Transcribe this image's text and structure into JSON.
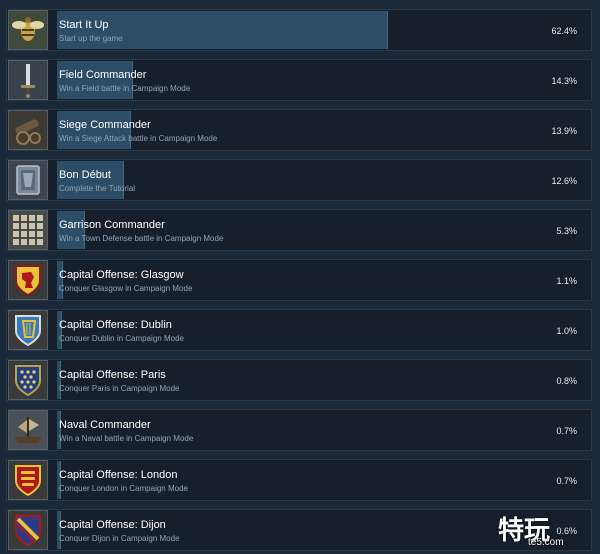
{
  "achievements": [
    {
      "title": "Start It Up",
      "description": "Start up the game",
      "percent_label": "62.4%",
      "percent": 62.4,
      "icon": "bee-emblem-icon"
    },
    {
      "title": "Field Commander",
      "description": "Win a Field battle in Campaign Mode",
      "percent_label": "14.3%",
      "percent": 14.3,
      "icon": "sword-icon"
    },
    {
      "title": "Siege Commander",
      "description": "Win a Siege Attack battle in Campaign Mode",
      "percent_label": "13.9%",
      "percent": 13.9,
      "icon": "cannon-icon"
    },
    {
      "title": "Bon Début",
      "description": "Complete the Tutorial",
      "percent_label": "12.6%",
      "percent": 12.6,
      "icon": "shield-icon"
    },
    {
      "title": "Garrison Commander",
      "description": "Win a Town Defense battle in Campaign Mode",
      "percent_label": "5.3%",
      "percent": 5.3,
      "icon": "fortress-wall-icon"
    },
    {
      "title": "Capital Offense: Glasgow",
      "description": "Conquer Glasgow in Campaign Mode",
      "percent_label": "1.1%",
      "percent": 1.1,
      "icon": "lion-crest-icon"
    },
    {
      "title": "Capital Offense: Dublin",
      "description": "Conquer Dublin in Campaign Mode",
      "percent_label": "1.0%",
      "percent": 1.0,
      "icon": "harp-crest-icon"
    },
    {
      "title": "Capital Offense: Paris",
      "description": "Conquer Paris in Campaign Mode",
      "percent_label": "0.8%",
      "percent": 0.8,
      "icon": "fleur-de-lis-crest-icon"
    },
    {
      "title": "Naval Commander",
      "description": "Win a Naval battle in Campaign Mode",
      "percent_label": "0.7%",
      "percent": 0.7,
      "icon": "ship-icon"
    },
    {
      "title": "Capital Offense: London",
      "description": "Conquer London in Campaign Mode",
      "percent_label": "0.7%",
      "percent": 0.7,
      "icon": "three-lions-crest-icon"
    },
    {
      "title": "Capital Offense: Dijon",
      "description": "Conquer Dijon in Campaign Mode",
      "percent_label": "0.6%",
      "percent": 0.6,
      "icon": "burgundy-crest-icon"
    }
  ],
  "watermark": {
    "text": "特玩",
    "sub": "te5.com"
  },
  "colors": {
    "background": "#1b2838",
    "row": "#16202d",
    "bar": "#2d4d66",
    "desc": "#8fa5b8"
  }
}
